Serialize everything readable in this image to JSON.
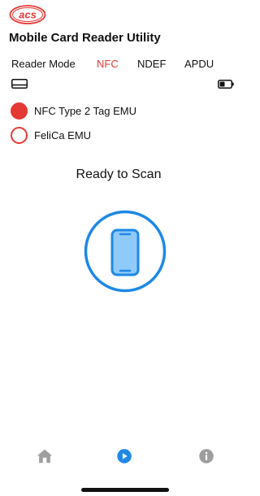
{
  "app": {
    "logo_text": "acs",
    "title": "Mobile Card Reader Utility"
  },
  "tabs": [
    {
      "label": "Reader Mode",
      "active": false
    },
    {
      "label": "NFC",
      "active": true
    },
    {
      "label": "NDEF",
      "active": false
    },
    {
      "label": "APDU",
      "active": false
    }
  ],
  "status_icons": {
    "left": "card-reader-icon",
    "right": "battery-icon"
  },
  "emulation_options": [
    {
      "label": "NFC Type 2 Tag EMU",
      "selected": true
    },
    {
      "label": "FeliCa EMU",
      "selected": false
    }
  ],
  "scan": {
    "status": "Ready to Scan",
    "icon": "phone-scan-icon"
  },
  "bottom_nav": [
    {
      "icon": "home-icon"
    },
    {
      "icon": "play-icon",
      "active": true
    },
    {
      "icon": "info-icon"
    }
  ],
  "colors": {
    "accent": "#e53935",
    "scan_blue": "#1e88e5",
    "phone_fill": "#90caf9",
    "nav_gray": "#9e9e9e"
  }
}
